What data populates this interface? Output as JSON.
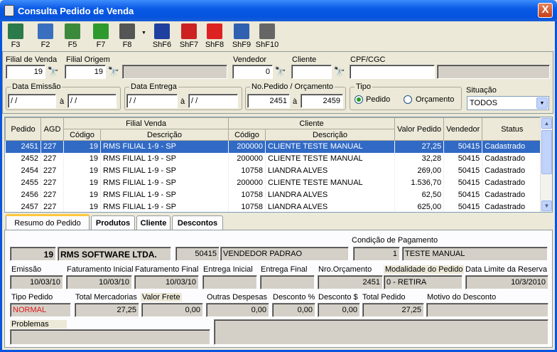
{
  "window": {
    "title": "Consulta Pedido de Venda",
    "close_label": "X"
  },
  "toolbar": [
    {
      "label": "F3",
      "icon": "exit-door-icon",
      "color": "#2a7a4a"
    },
    {
      "label": "F2",
      "icon": "new-record-icon",
      "color": "#3a6fc0"
    },
    {
      "label": "F5",
      "icon": "clear-icon",
      "color": "#3b8a3b"
    },
    {
      "label": "F7",
      "icon": "chart-icon",
      "color": "#2e9a2e"
    },
    {
      "label": "F8",
      "icon": "printer-icon",
      "color": "#555555"
    },
    {
      "label": "ShF6",
      "icon": "save-disk-icon",
      "color": "#2040a0"
    },
    {
      "label": "ShF7",
      "icon": "truck-icon",
      "color": "#cc2222"
    },
    {
      "label": "ShF8",
      "icon": "approve-envelope-icon",
      "color": "#d22"
    },
    {
      "label": "ShF9",
      "icon": "computer-icon",
      "color": "#3060b0"
    },
    {
      "label": "ShF10",
      "icon": "lock-icon",
      "color": "#666666"
    }
  ],
  "filters": {
    "filial_venda_label": "Filial de Venda",
    "filial_venda_value": "19",
    "filial_origem_label": "Filial Origem",
    "filial_origem_value": "19",
    "vendedor_label": "Vendedor",
    "vendedor_value": "0",
    "cliente_label": "Cliente",
    "cliente_value": "",
    "cpf_label": "CPF/CGC",
    "cpf_value": "",
    "data_emissao_label": "Data Emissão",
    "data_emissao_de": " / /",
    "data_emissao_ate": " / /",
    "data_entrega_label": "Data Entrega",
    "data_entrega_de": " / /",
    "data_entrega_ate": " / /",
    "ate_label": "à",
    "nopedido_label": "No.Pedido / Orçamento",
    "nopedido_de": "2451",
    "nopedido_ate": "2459",
    "tipo_label": "Tipo",
    "tipo_pedido": "Pedido",
    "tipo_orcamento": "Orçamento",
    "situacao_label": "Situação",
    "situacao_value": "TODOS"
  },
  "grid": {
    "headers": {
      "pedido": "Pedido",
      "agd": "AGD",
      "filial_venda": "Filial Venda",
      "codigo": "Código",
      "descricao": "Descrição",
      "cliente": "Cliente",
      "valor": "Valor Pedido",
      "vendedor": "Vendedor",
      "status": "Status"
    },
    "rows": [
      {
        "pedido": "2451",
        "agd": "227",
        "fcod": "19",
        "fdesc": "RMS FILIAL 1-9 - SP",
        "ccod": "200000",
        "cdesc": "CLIENTE TESTE MANUAL",
        "valor": "27,25",
        "vend": "50415",
        "status": "Cadastrado"
      },
      {
        "pedido": "2452",
        "agd": "227",
        "fcod": "19",
        "fdesc": "RMS FILIAL 1-9 - SP",
        "ccod": "200000",
        "cdesc": "CLIENTE TESTE MANUAL",
        "valor": "32,28",
        "vend": "50415",
        "status": "Cadastrado"
      },
      {
        "pedido": "2454",
        "agd": "227",
        "fcod": "19",
        "fdesc": "RMS FILIAL 1-9 - SP",
        "ccod": "10758",
        "cdesc": "LIANDRA ALVES",
        "valor": "269,00",
        "vend": "50415",
        "status": "Cadastrado"
      },
      {
        "pedido": "2455",
        "agd": "227",
        "fcod": "19",
        "fdesc": "RMS FILIAL 1-9 - SP",
        "ccod": "200000",
        "cdesc": "CLIENTE TESTE MANUAL",
        "valor": "1.536,70",
        "vend": "50415",
        "status": "Cadastrado"
      },
      {
        "pedido": "2456",
        "agd": "227",
        "fcod": "19",
        "fdesc": "RMS FILIAL 1-9 - SP",
        "ccod": "10758",
        "cdesc": "LIANDRA ALVES",
        "valor": "62,50",
        "vend": "50415",
        "status": "Cadastrado"
      },
      {
        "pedido": "2457",
        "agd": "227",
        "fcod": "19",
        "fdesc": "RMS FILIAL 1-9 - SP",
        "ccod": "10758",
        "cdesc": "LIANDRA ALVES",
        "valor": "625,00",
        "vend": "50415",
        "status": "Cadastrado"
      }
    ]
  },
  "tabs": [
    "Resumo do Pedido",
    "Produtos",
    "Cliente",
    "Descontos"
  ],
  "resumo": {
    "condicao_label": "Condição de Pagamento",
    "filial_cod": "19",
    "filial_nome": "RMS SOFTWARE LTDA.",
    "vend_cod": "50415",
    "vend_nome": "VENDEDOR PADRAO",
    "cond_cod": "1",
    "cond_nome": "TESTE MANUAL",
    "emissao_label": "Emissão",
    "emissao": "10/03/10",
    "fat_ini_label": "Faturamento Inicial",
    "fat_ini": "10/03/10",
    "fat_fin_label": "Faturamento Final",
    "fat_fin": "10/03/10",
    "ent_ini_label": "Entrega Inicial",
    "ent_ini": "",
    "ent_fin_label": "Entrega Final",
    "ent_fin": "",
    "nro_orc_label": "Nro.Orçamento",
    "nro_orc": "2451",
    "modalidade_label": "Modalidade do Pedido",
    "modalidade": "0 - RETIRA",
    "limite_label": "Data Limite da Reserva",
    "limite": "10/3/2010",
    "tipo_label": "Tipo Pedido",
    "tipo": "NORMAL",
    "tot_merc_label": "Total Mercadorias",
    "tot_merc": "27,25",
    "frete_label": "Valor Frete",
    "frete": "0,00",
    "outras_label": "Outras Despesas",
    "outras": "0,00",
    "desc_pct_label": "Desconto %",
    "desc_pct": "0,00",
    "desc_val_label": "Desconto $",
    "desc_val": "0,00",
    "tot_ped_label": "Total Pedido",
    "tot_ped": "27,25",
    "motivo_label": "Motivo do Desconto",
    "motivo": "",
    "problemas_label": "Problemas",
    "problemas": ""
  }
}
